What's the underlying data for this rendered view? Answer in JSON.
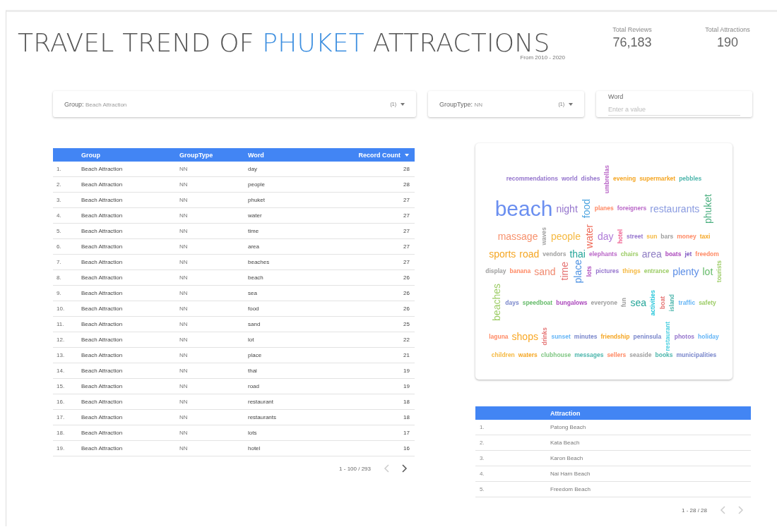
{
  "header": {
    "title": [
      {
        "text": "TRAVEL TREND OF",
        "highlight": false
      },
      {
        "text": "PHUKET",
        "highlight": true
      },
      {
        "text": "ATTRACTIONS",
        "highlight": false
      }
    ],
    "subtitle": "From 2010 - 2020"
  },
  "scorecards": [
    {
      "label": "Total Reviews",
      "value": "76,183"
    },
    {
      "label": "Total Attractions",
      "value": "190"
    }
  ],
  "filters": [
    {
      "kind": "dropdown",
      "label": "Group:",
      "value": "Beach Attraction",
      "count": "(1)"
    },
    {
      "kind": "dropdown",
      "label": "GroupType:",
      "value": "NN",
      "count": "(1)"
    },
    {
      "kind": "input",
      "label": "Word",
      "placeholder": "Enter a value"
    }
  ],
  "word_table": {
    "columns": [
      "",
      "Group",
      "GroupType",
      "Word",
      "Record Count"
    ],
    "rows": [
      [
        "1.",
        "Beach Attraction",
        "NN",
        "day",
        "28"
      ],
      [
        "2.",
        "Beach Attraction",
        "NN",
        "people",
        "28"
      ],
      [
        "3.",
        "Beach Attraction",
        "NN",
        "phuket",
        "27"
      ],
      [
        "4.",
        "Beach Attraction",
        "NN",
        "water",
        "27"
      ],
      [
        "5.",
        "Beach Attraction",
        "NN",
        "time",
        "27"
      ],
      [
        "6.",
        "Beach Attraction",
        "NN",
        "area",
        "27"
      ],
      [
        "7.",
        "Beach Attraction",
        "NN",
        "beaches",
        "27"
      ],
      [
        "8.",
        "Beach Attraction",
        "NN",
        "beach",
        "26"
      ],
      [
        "9.",
        "Beach Attraction",
        "NN",
        "sea",
        "26"
      ],
      [
        "10.",
        "Beach Attraction",
        "NN",
        "food",
        "26"
      ],
      [
        "11.",
        "Beach Attraction",
        "NN",
        "sand",
        "25"
      ],
      [
        "12.",
        "Beach Attraction",
        "NN",
        "lot",
        "22"
      ],
      [
        "13.",
        "Beach Attraction",
        "NN",
        "place",
        "21"
      ],
      [
        "14.",
        "Beach Attraction",
        "NN",
        "thai",
        "19"
      ],
      [
        "15.",
        "Beach Attraction",
        "NN",
        "road",
        "19"
      ],
      [
        "16.",
        "Beach Attraction",
        "NN",
        "restaurant",
        "18"
      ],
      [
        "17.",
        "Beach Attraction",
        "NN",
        "restaurants",
        "18"
      ],
      [
        "18.",
        "Beach Attraction",
        "NN",
        "lots",
        "17"
      ],
      [
        "19.",
        "Beach Attraction",
        "NN",
        "hotel",
        "16"
      ]
    ],
    "pagination": {
      "range": "1 - 100 / 293",
      "prev_disabled": true,
      "next_disabled": false
    }
  },
  "word_cloud": [
    {
      "text": "recommendations",
      "kind": "small",
      "vertical": false,
      "color": "#9575cd"
    },
    {
      "text": "world",
      "kind": "small",
      "vertical": false,
      "color": "#9575cd"
    },
    {
      "text": "dishes",
      "kind": "small",
      "vertical": false,
      "color": "#9575cd"
    },
    {
      "text": "umbrellas",
      "kind": "small",
      "vertical": true,
      "color": "#ba68c8"
    },
    {
      "text": "evening",
      "kind": "small",
      "vertical": false,
      "color": "#f5a623"
    },
    {
      "text": "supermarket",
      "kind": "small",
      "vertical": false,
      "color": "#f5a623"
    },
    {
      "text": "pebbles",
      "kind": "small",
      "vertical": false,
      "color": "#4db6ac"
    },
    {
      "text": "beach",
      "kind": "large",
      "vertical": false,
      "color": "#6b8ff0"
    },
    {
      "text": "night",
      "kind": "medium",
      "vertical": false,
      "color": "#9575cd"
    },
    {
      "text": "food",
      "kind": "medium",
      "vertical": true,
      "color": "#4aa3df"
    },
    {
      "text": "planes",
      "kind": "small",
      "vertical": false,
      "color": "#ff8a65"
    },
    {
      "text": "foreigners",
      "kind": "small",
      "vertical": false,
      "color": "#ba68c8"
    },
    {
      "text": "restaurants",
      "kind": "medium",
      "vertical": false,
      "color": "#8a9be0"
    },
    {
      "text": "phuket",
      "kind": "medium",
      "vertical": true,
      "color": "#4caf80"
    },
    {
      "text": "massage",
      "kind": "medium",
      "vertical": false,
      "color": "#f7926e"
    },
    {
      "text": "waves",
      "kind": "small",
      "vertical": true,
      "color": "#9e9e9e"
    },
    {
      "text": "people",
      "kind": "medium",
      "vertical": false,
      "color": "#f5b942"
    },
    {
      "text": "water",
      "kind": "medium",
      "vertical": true,
      "color": "#ef6c5a"
    },
    {
      "text": "day",
      "kind": "medium",
      "vertical": false,
      "color": "#b07cd8"
    },
    {
      "text": "hotel",
      "kind": "small",
      "vertical": true,
      "color": "#f06292"
    },
    {
      "text": "street",
      "kind": "small",
      "vertical": false,
      "color": "#9575cd"
    },
    {
      "text": "sun",
      "kind": "small",
      "vertical": false,
      "color": "#f5b942"
    },
    {
      "text": "bars",
      "kind": "small",
      "vertical": false,
      "color": "#9e9e9e"
    },
    {
      "text": "money",
      "kind": "small",
      "vertical": false,
      "color": "#ff8a65"
    },
    {
      "text": "taxi",
      "kind": "small",
      "vertical": false,
      "color": "#f5a623"
    },
    {
      "text": "sports",
      "kind": "medium",
      "vertical": false,
      "color": "#f5a623"
    },
    {
      "text": "road",
      "kind": "medium",
      "vertical": false,
      "color": "#f5a623"
    },
    {
      "text": "vendors",
      "kind": "small",
      "vertical": false,
      "color": "#9e9e9e"
    },
    {
      "text": "thai",
      "kind": "medium",
      "vertical": false,
      "color": "#26a69a"
    },
    {
      "text": "elephants",
      "kind": "small",
      "vertical": false,
      "color": "#ba68c8"
    },
    {
      "text": "chairs",
      "kind": "small",
      "vertical": false,
      "color": "#9ccc65"
    },
    {
      "text": "area",
      "kind": "medium",
      "vertical": false,
      "color": "#8e7cc3"
    },
    {
      "text": "boats",
      "kind": "small",
      "vertical": false,
      "color": "#ab47bc"
    },
    {
      "text": "jet",
      "kind": "small",
      "vertical": false,
      "color": "#7e57c2"
    },
    {
      "text": "freedom",
      "kind": "small",
      "vertical": false,
      "color": "#ff8a65"
    },
    {
      "text": "display",
      "kind": "small",
      "vertical": false,
      "color": "#9e9e9e"
    },
    {
      "text": "banana",
      "kind": "small",
      "vertical": false,
      "color": "#ff8a65"
    },
    {
      "text": "sand",
      "kind": "medium",
      "vertical": false,
      "color": "#f08a70"
    },
    {
      "text": "time",
      "kind": "medium",
      "vertical": true,
      "color": "#e57373"
    },
    {
      "text": "place",
      "kind": "medium",
      "vertical": true,
      "color": "#4a90e2"
    },
    {
      "text": "lots",
      "kind": "small",
      "vertical": true,
      "color": "#ab47bc"
    },
    {
      "text": "pictures",
      "kind": "small",
      "vertical": false,
      "color": "#9575cd"
    },
    {
      "text": "things",
      "kind": "small",
      "vertical": false,
      "color": "#f5b942"
    },
    {
      "text": "entrance",
      "kind": "small",
      "vertical": false,
      "color": "#9ccc65"
    },
    {
      "text": "plenty",
      "kind": "medium",
      "vertical": false,
      "color": "#5c8ee6"
    },
    {
      "text": "lot",
      "kind": "medium",
      "vertical": false,
      "color": "#66bb6a"
    },
    {
      "text": "tourists",
      "kind": "small",
      "vertical": true,
      "color": "#9ccc65"
    },
    {
      "text": "beaches",
      "kind": "medium",
      "vertical": true,
      "color": "#9ccc65"
    },
    {
      "text": "days",
      "kind": "small",
      "vertical": false,
      "color": "#7986cb"
    },
    {
      "text": "speedboat",
      "kind": "small",
      "vertical": false,
      "color": "#66bb6a"
    },
    {
      "text": "bungalows",
      "kind": "small",
      "vertical": false,
      "color": "#ab47bc"
    },
    {
      "text": "everyone",
      "kind": "small",
      "vertical": false,
      "color": "#9e9e9e"
    },
    {
      "text": "fun",
      "kind": "small",
      "vertical": true,
      "color": "#9e9e9e"
    },
    {
      "text": "sea",
      "kind": "medium",
      "vertical": false,
      "color": "#26a69a"
    },
    {
      "text": "activities",
      "kind": "small",
      "vertical": true,
      "color": "#26c6da"
    },
    {
      "text": "boat",
      "kind": "small",
      "vertical": true,
      "color": "#e57373"
    },
    {
      "text": "island",
      "kind": "small",
      "vertical": true,
      "color": "#4db6ac"
    },
    {
      "text": "traffic",
      "kind": "small",
      "vertical": false,
      "color": "#64b5f6"
    },
    {
      "text": "safety",
      "kind": "small",
      "vertical": false,
      "color": "#9ccc65"
    },
    {
      "text": "laguna",
      "kind": "small",
      "vertical": false,
      "color": "#ff8a65"
    },
    {
      "text": "shops",
      "kind": "medium",
      "vertical": false,
      "color": "#f9a825"
    },
    {
      "text": "drinks",
      "kind": "small",
      "vertical": true,
      "color": "#e57373"
    },
    {
      "text": "sunset",
      "kind": "small",
      "vertical": false,
      "color": "#64b5f6"
    },
    {
      "text": "minutes",
      "kind": "small",
      "vertical": false,
      "color": "#7986cb"
    },
    {
      "text": "friendship",
      "kind": "small",
      "vertical": false,
      "color": "#f5a623"
    },
    {
      "text": "peninsula",
      "kind": "small",
      "vertical": false,
      "color": "#7986cb"
    },
    {
      "text": "restaurant",
      "kind": "small",
      "vertical": true,
      "color": "#4dd0e1"
    },
    {
      "text": "photos",
      "kind": "small",
      "vertical": false,
      "color": "#9575cd"
    },
    {
      "text": "holiday",
      "kind": "small",
      "vertical": false,
      "color": "#64b5f6"
    },
    {
      "text": "children",
      "kind": "small",
      "vertical": false,
      "color": "#f5b942"
    },
    {
      "text": "waters",
      "kind": "small",
      "vertical": false,
      "color": "#f5a623"
    },
    {
      "text": "clubhouse",
      "kind": "small",
      "vertical": false,
      "color": "#81c784"
    },
    {
      "text": "messages",
      "kind": "small",
      "vertical": false,
      "color": "#4db6ac"
    },
    {
      "text": "sellers",
      "kind": "small",
      "vertical": false,
      "color": "#ff8a65"
    },
    {
      "text": "seaside",
      "kind": "small",
      "vertical": false,
      "color": "#9e9e9e"
    },
    {
      "text": "books",
      "kind": "small",
      "vertical": false,
      "color": "#4db6ac"
    },
    {
      "text": "municipalities",
      "kind": "small",
      "vertical": false,
      "color": "#7986cb"
    }
  ],
  "attraction_table": {
    "columns": [
      "",
      "Attraction"
    ],
    "rows": [
      [
        "1.",
        "Patong Beach"
      ],
      [
        "2.",
        "Kata Beach"
      ],
      [
        "3.",
        "Karon Beach"
      ],
      [
        "4.",
        "Nai Harn Beach"
      ],
      [
        "5.",
        "Freedom Beach"
      ]
    ],
    "pagination": {
      "range": "1 - 28 / 28",
      "prev_disabled": true,
      "next_disabled": true
    }
  }
}
